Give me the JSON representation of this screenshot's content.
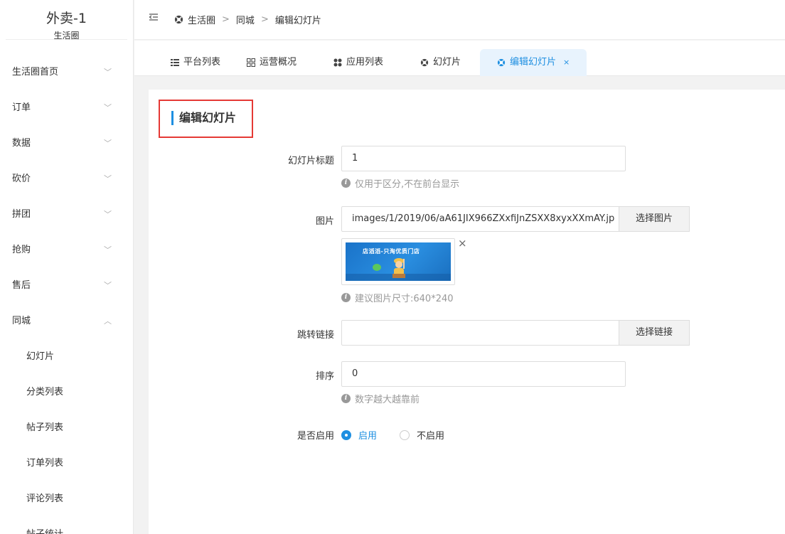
{
  "sidebar": {
    "brand_name": "外卖-1",
    "brand_sub": "生活圈",
    "items": [
      {
        "label": "生活圈首页"
      },
      {
        "label": "订单"
      },
      {
        "label": "数据"
      },
      {
        "label": "砍价"
      },
      {
        "label": "拼团"
      },
      {
        "label": "抢购"
      },
      {
        "label": "售后"
      },
      {
        "label": "同城"
      }
    ],
    "sub_items": [
      {
        "label": "幻灯片"
      },
      {
        "label": "分类列表"
      },
      {
        "label": "帖子列表"
      },
      {
        "label": "订单列表"
      },
      {
        "label": "评论列表"
      },
      {
        "label": "帖子统计"
      }
    ]
  },
  "breadcrumb": {
    "items": [
      "生活圈",
      "同城",
      "编辑幻灯片"
    ],
    "separator": ">"
  },
  "tabs": [
    {
      "label": "平台列表"
    },
    {
      "label": "运营概况"
    },
    {
      "label": "应用列表"
    },
    {
      "label": "幻灯片"
    },
    {
      "label": "编辑幻灯片",
      "active": true,
      "close": "×"
    }
  ],
  "form": {
    "section_title": "编辑幻灯片",
    "title_label": "幻灯片标题",
    "title_value": "1",
    "title_help": "仅用于区分,不在前台显示",
    "image_label": "图片",
    "image_value": "images/1/2019/06/aA61JIX966ZXxfiJnZSXX8xyxXXmAY.jp",
    "image_button": "选择图片",
    "image_preview_text": "店滔滔-只淘优质门店",
    "image_remove": "×",
    "image_help": "建议图片尺寸:640*240",
    "link_label": "跳转链接",
    "link_value": "",
    "link_button": "选择链接",
    "sort_label": "排序",
    "sort_value": "0",
    "sort_help": "数字越大越靠前",
    "enable_label": "是否启用",
    "enable_on": "启用",
    "enable_off": "不启用",
    "enabled": true
  },
  "colors": {
    "accent": "#1e8fe1",
    "highlight_box": "#e53935"
  }
}
